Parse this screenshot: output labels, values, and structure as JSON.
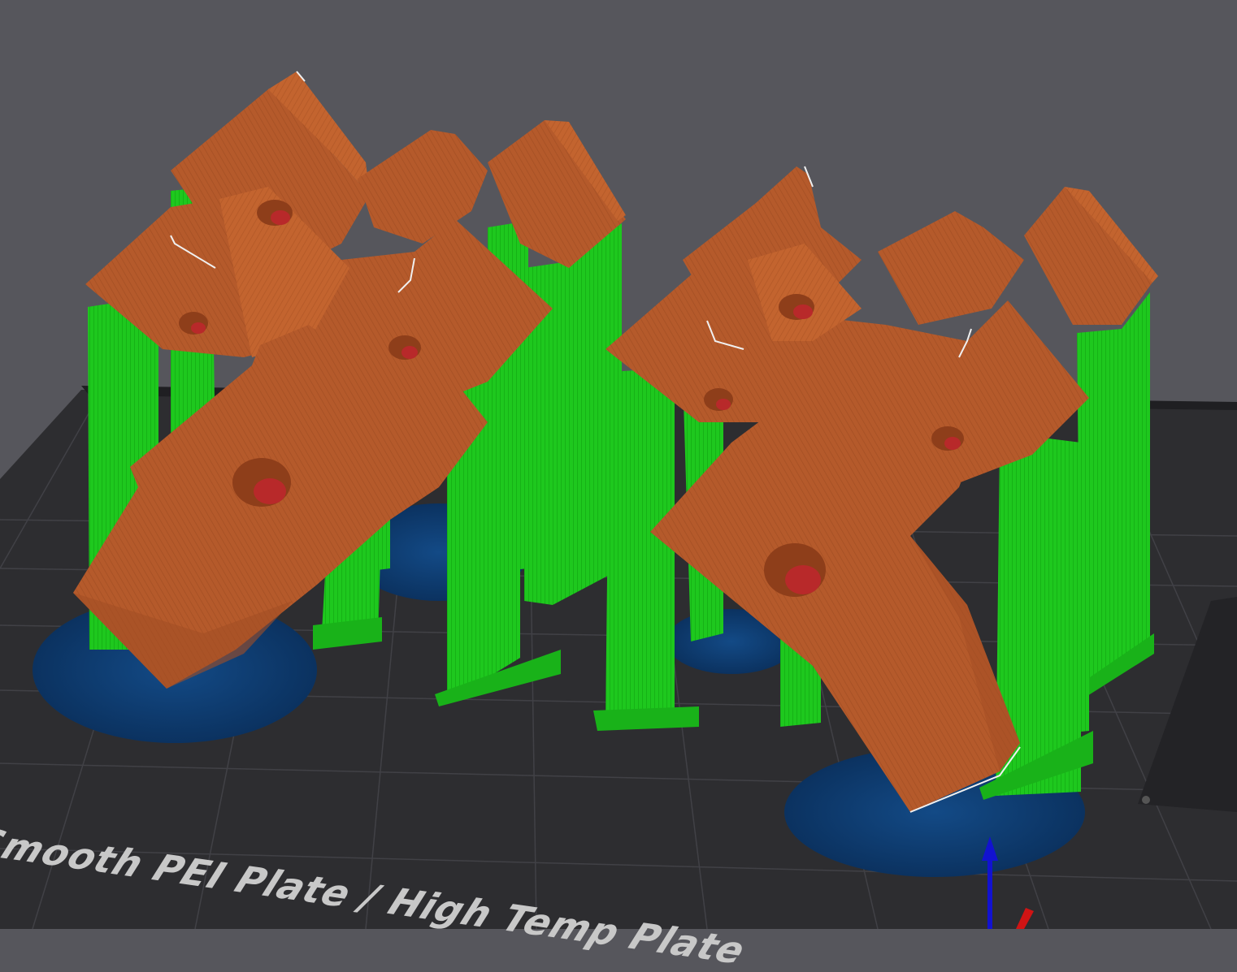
{
  "viewport": {
    "bed": {
      "plate_label": "Smooth PEI Plate / High Temp Plate",
      "plate_label_visible_prefix_cut": true
    },
    "colors": {
      "background": "#56565c",
      "bed_surface": "#2c2c2e",
      "grid_lines": "#3e3e42",
      "model_body": "#b55a2b",
      "model_highlight": "#c96a35",
      "support": "#18c418",
      "support_dark": "#0f9a0f",
      "brim": "#0e3a6b",
      "z_axis": "#1010d0",
      "x_axis": "#d01010"
    },
    "icons": [
      "z-axis-arrow-icon",
      "x-axis-arrow-icon",
      "bed-corner-marker-icon"
    ]
  }
}
